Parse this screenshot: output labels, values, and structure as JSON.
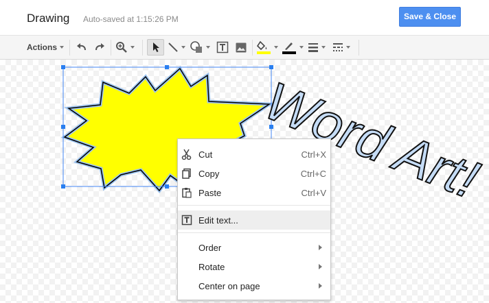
{
  "header": {
    "title": "Drawing",
    "autosave": "Auto-saved at 1:15:26 PM",
    "save_button": "Save & Close"
  },
  "toolbar": {
    "actions_label": "Actions",
    "tools": [
      "undo-icon",
      "redo-icon",
      "zoom-icon",
      "select-icon",
      "line-icon",
      "shape-icon",
      "text-box-icon",
      "image-icon",
      "fill-color-icon",
      "line-color-icon",
      "line-weight-icon",
      "line-dash-icon"
    ],
    "fill_color": "#ffff00",
    "line_color": "#000000"
  },
  "canvas": {
    "word_art_text": "Word Art!",
    "starburst_fill": "#ffff00"
  },
  "context_menu": {
    "items": [
      {
        "label": "Cut",
        "shortcut": "Ctrl+X",
        "icon": "scissors-icon"
      },
      {
        "label": "Copy",
        "shortcut": "Ctrl+C",
        "icon": "copy-icon"
      },
      {
        "label": "Paste",
        "shortcut": "Ctrl+V",
        "icon": "paste-icon"
      },
      {
        "label": "Edit text...",
        "icon": "edit-text-icon",
        "highlighted": true
      },
      {
        "label": "Order",
        "submenu": true
      },
      {
        "label": "Rotate",
        "submenu": true
      },
      {
        "label": "Center on page",
        "submenu": true
      }
    ]
  }
}
